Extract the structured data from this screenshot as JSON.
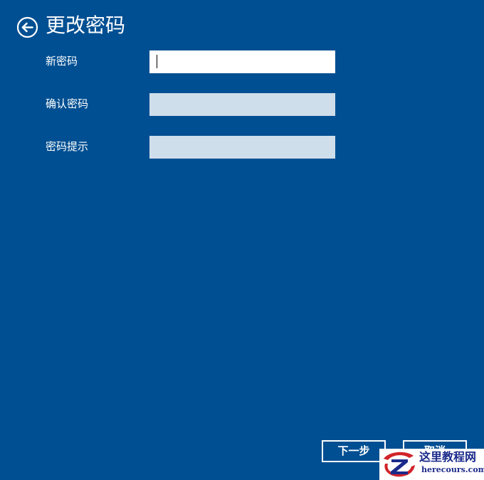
{
  "header": {
    "back_icon": "back-arrow-circle-icon",
    "title": "更改密码"
  },
  "form": {
    "new_password": {
      "label": "新密码",
      "value": ""
    },
    "confirm_password": {
      "label": "确认密码",
      "value": ""
    },
    "password_hint": {
      "label": "密码提示",
      "value": ""
    }
  },
  "footer": {
    "next_label": "下一步",
    "cancel_label": "取消"
  },
  "watermark": {
    "name": "这里教程网",
    "url": "herecours.com",
    "logo_icon": "z-logo-icon"
  },
  "colors": {
    "background": "#004f92",
    "text": "#ffffff",
    "active_input": "#ffffff",
    "inactive_input": "#cfdeeb",
    "watermark_text": "#1b2a8a",
    "watermark_logo_red": "#d2232a"
  }
}
